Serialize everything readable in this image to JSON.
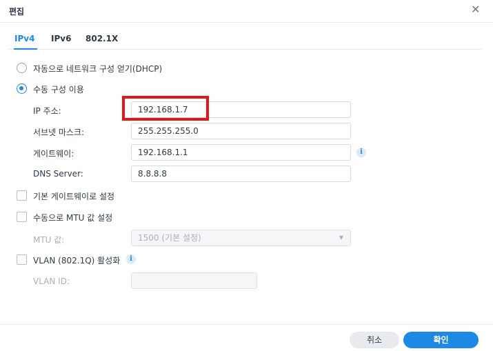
{
  "dialog": {
    "title": "편집",
    "close_icon": "close-icon"
  },
  "tabs": [
    {
      "label": "IPv4",
      "active": true
    },
    {
      "label": "IPv6",
      "active": false
    },
    {
      "label": "802.1X",
      "active": false
    }
  ],
  "options": {
    "dhcp_label": "자동으로 네트워크 구성 얻기(DHCP)",
    "dhcp_selected": false,
    "manual_label": "수동 구성 이용",
    "manual_selected": true
  },
  "fields": {
    "ip": {
      "label": "IP 주소:",
      "value": "192.168.1.7"
    },
    "subnet": {
      "label": "서브넷 마스크:",
      "value": "255.255.255.0"
    },
    "gateway": {
      "label": "게이트웨이:",
      "value": "192.168.1.1"
    },
    "dns": {
      "label": "DNS Server:",
      "value": "8.8.8.8"
    }
  },
  "checkboxes": {
    "default_gateway": {
      "label": "기본 게이트웨이로 설정",
      "checked": false
    },
    "manual_mtu": {
      "label": "수동으로 MTU 값 설정",
      "checked": false
    },
    "vlan": {
      "label": "VLAN (802.1Q) 활성화",
      "checked": false
    }
  },
  "mtu": {
    "label": "MTU 값:",
    "value": "1500 (기본 설정)"
  },
  "vlan_id": {
    "label": "VLAN ID:",
    "value": ""
  },
  "buttons": {
    "cancel": "취소",
    "ok": "확인"
  },
  "colors": {
    "accent": "#1e88e5",
    "highlight": "#e21818"
  }
}
